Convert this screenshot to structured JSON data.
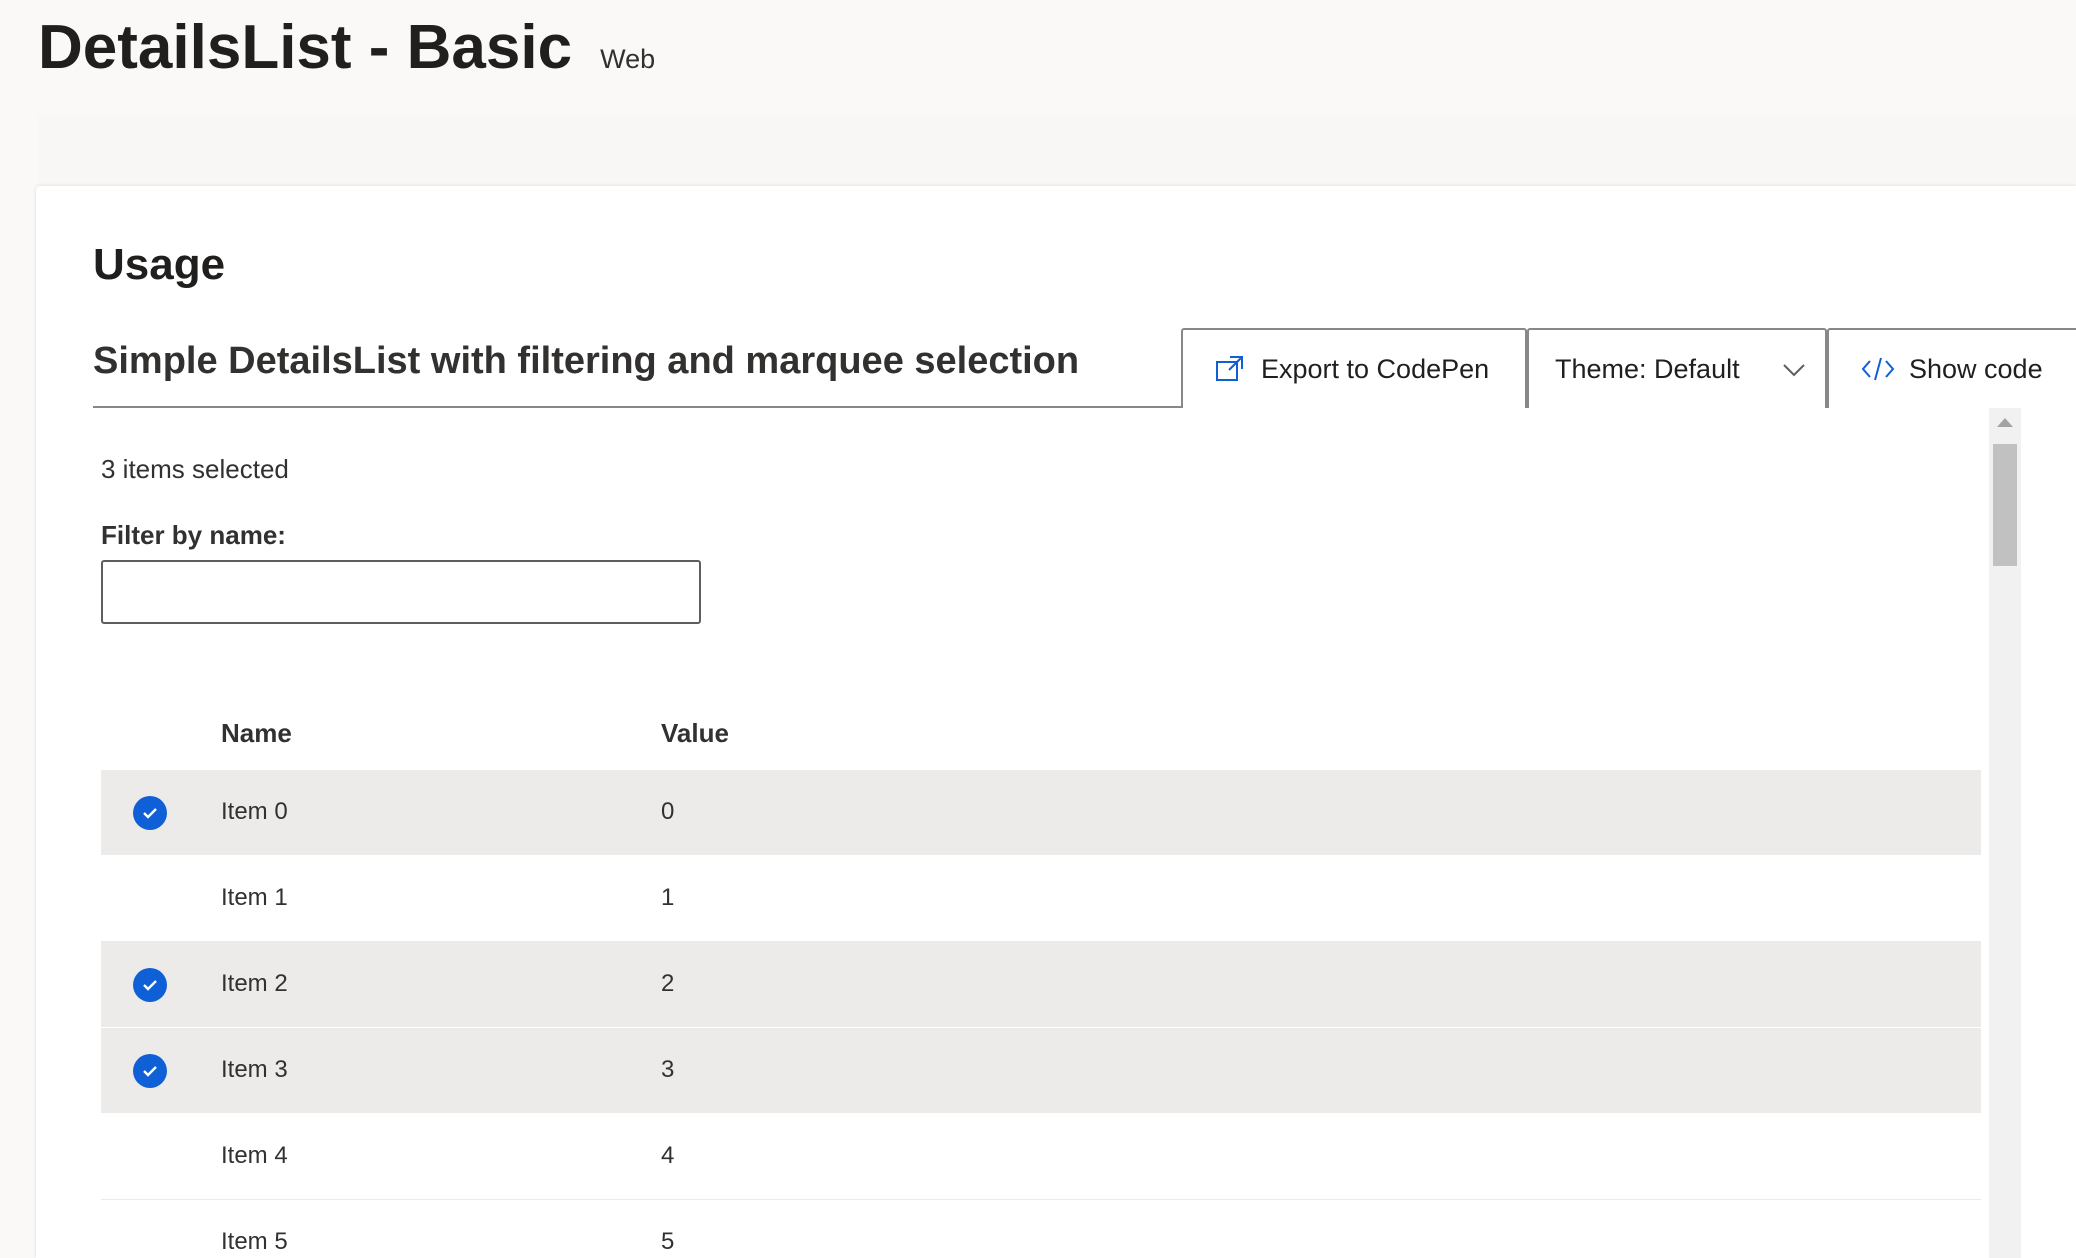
{
  "header": {
    "title": "DetailsList - Basic",
    "platform": "Web"
  },
  "usage": {
    "title": "Usage"
  },
  "example": {
    "title": "Simple DetailsList with filtering and marquee selection",
    "toolbar": {
      "export_label": "Export to CodePen",
      "theme_label": "Theme: Default",
      "show_code_label": "Show code"
    },
    "selection_text": "3 items selected",
    "filter": {
      "label": "Filter by name:",
      "value": "",
      "placeholder": ""
    },
    "columns": [
      "Name",
      "Value"
    ],
    "rows": [
      {
        "name": "Item 0",
        "value": "0",
        "selected": true
      },
      {
        "name": "Item 1",
        "value": "1",
        "selected": false
      },
      {
        "name": "Item 2",
        "value": "2",
        "selected": true
      },
      {
        "name": "Item 3",
        "value": "3",
        "selected": true
      },
      {
        "name": "Item 4",
        "value": "4",
        "selected": false
      },
      {
        "name": "Item 5",
        "value": "5",
        "selected": false
      }
    ]
  },
  "colors": {
    "accent": "#0f5fd6",
    "selected_row": "#edebe9",
    "border": "#8a8886"
  },
  "icons": {
    "export": "open-in-new-window-icon",
    "theme_dropdown": "chevron-down-icon",
    "show_code": "code-icon",
    "row_check": "check-circle-icon"
  }
}
